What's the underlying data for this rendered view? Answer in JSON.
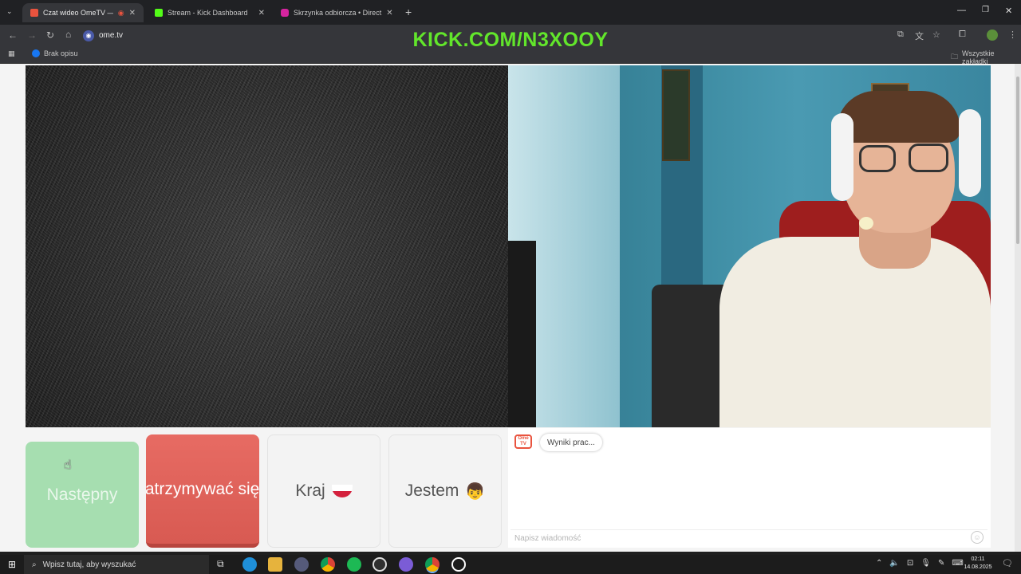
{
  "browser": {
    "tabs": [
      {
        "title": "Czat wideo OmeTV — alter",
        "active": true,
        "favicon_color": "#e9533e"
      },
      {
        "title": "Stream - Kick Dashboard",
        "active": false,
        "favicon_color": "#53fc18"
      },
      {
        "title": "Skrzynka odbiorcza • Direct",
        "active": false,
        "favicon_color": "#d6249f"
      }
    ],
    "url": "ome.tv",
    "bookmark": "Brak opisu",
    "all_bookmarks": "Wszystkie zakładki"
  },
  "overlay_text": "KICK.COM/N3XOOY",
  "controls": {
    "next": "Następny",
    "stop": "Zatrzymywać się",
    "country": "Kraj",
    "gender": "Jestem"
  },
  "chat": {
    "logo": "Ome TV",
    "system_message": "Wyniki prac...",
    "placeholder": "Napisz wiadomość"
  },
  "taskbar": {
    "search_placeholder": "Wpisz tutaj, aby wyszukać",
    "time": "02:11",
    "date": "14.08.2025"
  },
  "colors": {
    "overlay": "#62e62b",
    "next_button": "#a6deb0",
    "stop_button": "#e76b63"
  }
}
